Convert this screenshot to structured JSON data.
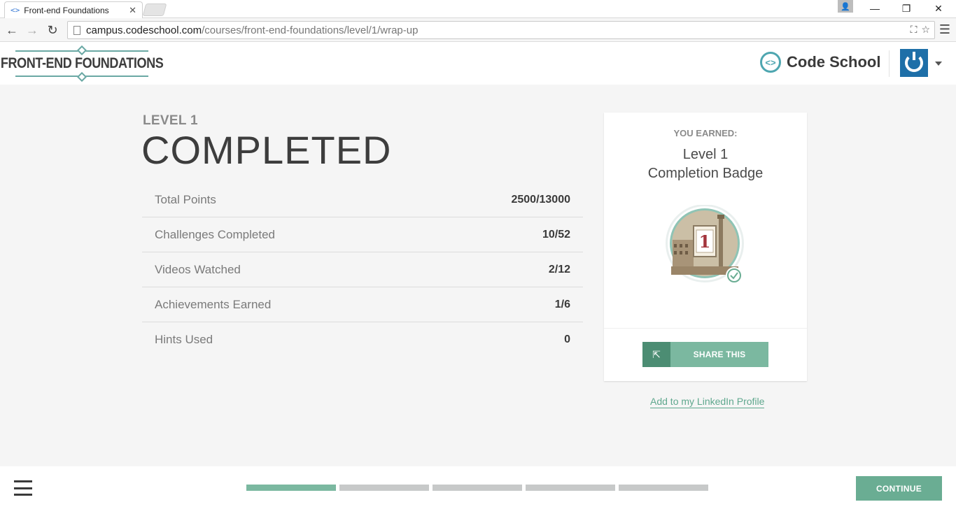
{
  "browser": {
    "tab_title": "Front-end Foundations",
    "tab_favicon": "code-brackets-icon",
    "url_host": "campus.codeschool.com",
    "url_path": "/courses/front-end-foundations/level/1/wrap-up"
  },
  "header": {
    "course_logo_text": "FRONT-END FOUNDATIONS",
    "brand_name": "Code School",
    "brand_icon": "code-brackets-icon",
    "avatar_icon": "power-icon"
  },
  "main": {
    "level_label": "LEVEL 1",
    "title": "COMPLETED",
    "stats": [
      {
        "label": "Total Points",
        "value": "2500/13000"
      },
      {
        "label": "Challenges Completed",
        "value": "10/52"
      },
      {
        "label": "Videos Watched",
        "value": "2/12"
      },
      {
        "label": "Achievements Earned",
        "value": "1/6"
      },
      {
        "label": "Hints Used",
        "value": "0"
      }
    ]
  },
  "badge_card": {
    "earned_label": "YOU EARNED:",
    "badge_line1": "Level 1",
    "badge_line2": "Completion Badge",
    "badge_number": "1",
    "share_label": "SHARE THIS",
    "linkedin_label": "Add to my LinkedIn Profile"
  },
  "footer": {
    "continue_label": "CONTINUE",
    "progress_completed_segments": 1,
    "progress_total_segments": 5
  },
  "colors": {
    "accent_green": "#7bb8a0",
    "dark_green": "#4c8d73",
    "brand_teal": "#4ea6b0",
    "avatar_blue": "#1e6fa8"
  }
}
